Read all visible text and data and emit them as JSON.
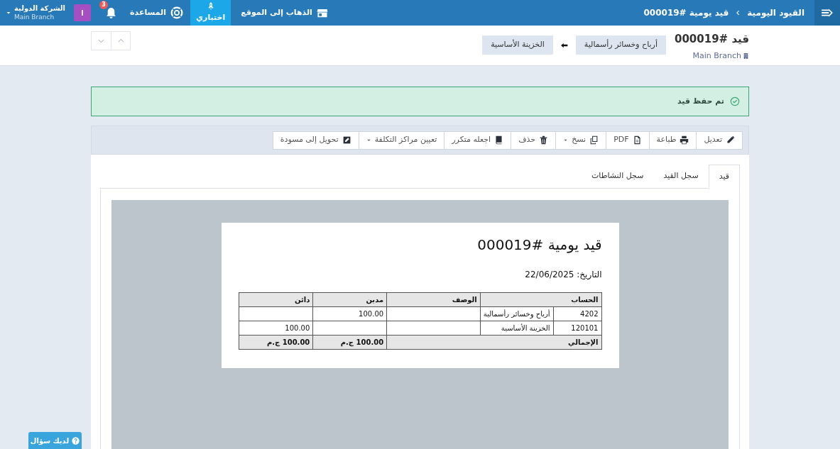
{
  "topbar": {
    "breadcrumb": [
      "القيود اليومية",
      "قيد يومية #000019"
    ],
    "links": [
      {
        "label": "الذهاب إلى الموقع",
        "kind": "store",
        "selected": false
      },
      {
        "label": "اختباري",
        "kind": "rocket",
        "selected": true
      }
    ],
    "help": "المساعدة",
    "notifications": "3",
    "avatar": "ا",
    "company": "الشركة الدولية",
    "branch": "Main Branch"
  },
  "header": {
    "title": "قيد #000019",
    "branch": "Main Branch",
    "from": "أرباح وخسائر رأسمالية",
    "to": "الخزينة الأساسية"
  },
  "alert": "تم حفظ قيد",
  "toolbar": [
    {
      "label": "تعديل",
      "kind": "pencil",
      "dropdown": false
    },
    {
      "label": "طباعة",
      "kind": "printer",
      "dropdown": false
    },
    {
      "label": "PDF",
      "kind": "file",
      "dropdown": false
    },
    {
      "label": "نسخ",
      "kind": "copy",
      "dropdown": true
    },
    {
      "label": "حذف",
      "kind": "trash",
      "dropdown": false
    },
    {
      "label": "اجعله متكرر",
      "kind": "book",
      "dropdown": false
    },
    {
      "label": "تعيين مراكز التكلفة",
      "kind": "none",
      "dropdown": true
    },
    {
      "label": "تحويل إلى مسودة",
      "kind": "edit",
      "dropdown": false
    }
  ],
  "tabs": [
    {
      "label": "قيد",
      "selected": true
    },
    {
      "label": "سجل القيد",
      "selected": false
    },
    {
      "label": "سجل النشاطات",
      "selected": false
    }
  ],
  "document": {
    "title": "قيد يومية #000019",
    "date_label": "التاريخ:",
    "date": "22/06/2025",
    "columns": [
      "الحساب",
      "الوصف",
      "مدين",
      "دائن"
    ],
    "rows": [
      {
        "code": "4202",
        "account": "أرباح وخسائر رأسمالية",
        "description": "",
        "debit": "100.00",
        "credit": ""
      },
      {
        "code": "120101",
        "account": "الخزينة الأساسية",
        "description": "",
        "debit": "",
        "credit": "100.00"
      }
    ],
    "total_label": "الإجمالي",
    "total_debit": "100.00 ج.م",
    "total_credit": "100.00 ج.م"
  },
  "help_button": "لديك سؤال"
}
